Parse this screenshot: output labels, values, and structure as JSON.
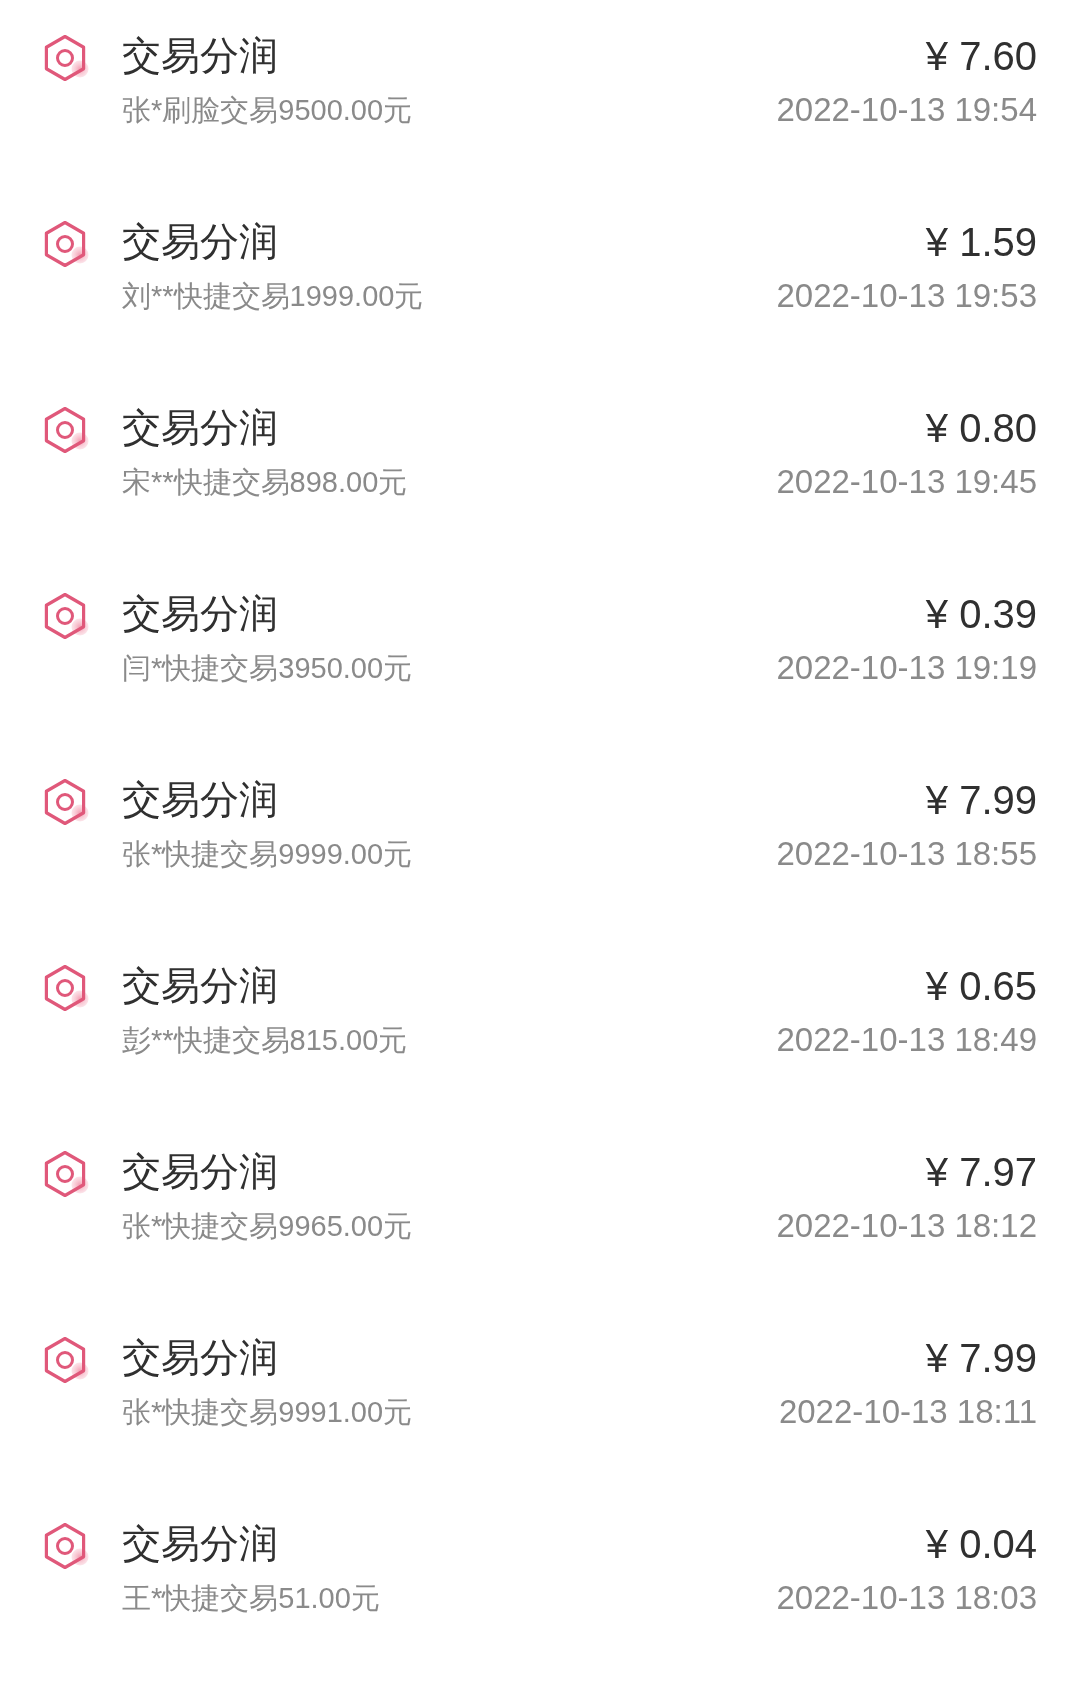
{
  "transactions": [
    {
      "title": "交易分润",
      "description": "张*刷脸交易9500.00元",
      "amount": "¥ 7.60",
      "time": "2022-10-13 19:54"
    },
    {
      "title": "交易分润",
      "description": "刘**快捷交易1999.00元",
      "amount": "¥ 1.59",
      "time": "2022-10-13 19:53"
    },
    {
      "title": "交易分润",
      "description": "宋**快捷交易898.00元",
      "amount": "¥ 0.80",
      "time": "2022-10-13 19:45"
    },
    {
      "title": "交易分润",
      "description": "闫*快捷交易3950.00元",
      "amount": "¥ 0.39",
      "time": "2022-10-13 19:19"
    },
    {
      "title": "交易分润",
      "description": "张*快捷交易9999.00元",
      "amount": "¥ 7.99",
      "time": "2022-10-13 18:55"
    },
    {
      "title": "交易分润",
      "description": "彭**快捷交易815.00元",
      "amount": "¥ 0.65",
      "time": "2022-10-13 18:49"
    },
    {
      "title": "交易分润",
      "description": "张*快捷交易9965.00元",
      "amount": "¥ 7.97",
      "time": "2022-10-13 18:12"
    },
    {
      "title": "交易分润",
      "description": "张*快捷交易9991.00元",
      "amount": "¥ 7.99",
      "time": "2022-10-13 18:11"
    },
    {
      "title": "交易分润",
      "description": "王*快捷交易51.00元",
      "amount": "¥ 0.04",
      "time": "2022-10-13 18:03"
    }
  ]
}
